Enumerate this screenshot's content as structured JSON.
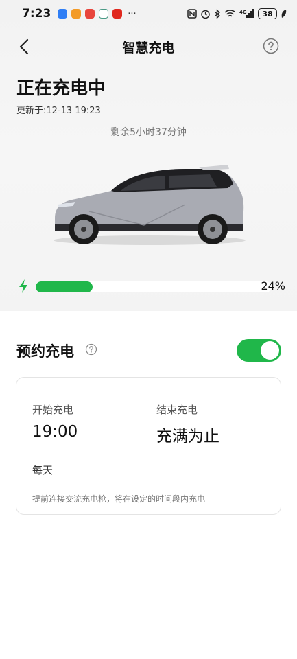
{
  "status_bar": {
    "time": "7:23",
    "more": "···",
    "battery": "38",
    "network": "4G",
    "app_icons": [
      {
        "name": "blue-app-icon",
        "color": "#2f7ef5"
      },
      {
        "name": "orange-app-icon",
        "color": "#f39a26"
      },
      {
        "name": "red-app-icon",
        "color": "#e8453c"
      },
      {
        "name": "home-app-icon",
        "color": "#4a9a86"
      },
      {
        "name": "red-chart-app-icon",
        "color": "#e0281e"
      }
    ]
  },
  "header": {
    "title": "智慧充电",
    "back_icon": "chevron-left-icon",
    "help_icon": "question-circle-icon"
  },
  "charging": {
    "status": "正在充电中",
    "updated_label": "更新于:",
    "updated_time": "12-13 19:23",
    "remaining": "剩余5小时37分钟",
    "percent_text": "24%",
    "percent": 24,
    "bar_color": "#20b74a"
  },
  "schedule": {
    "title": "预约充电",
    "enabled": true,
    "toggle_color": "#20b74a",
    "start_label": "开始充电",
    "start_value": "19:00",
    "end_label": "结束充电",
    "end_value": "充满为止",
    "repeat": "每天",
    "hint": "提前连接交流充电枪，将在设定的时间段内充电"
  }
}
